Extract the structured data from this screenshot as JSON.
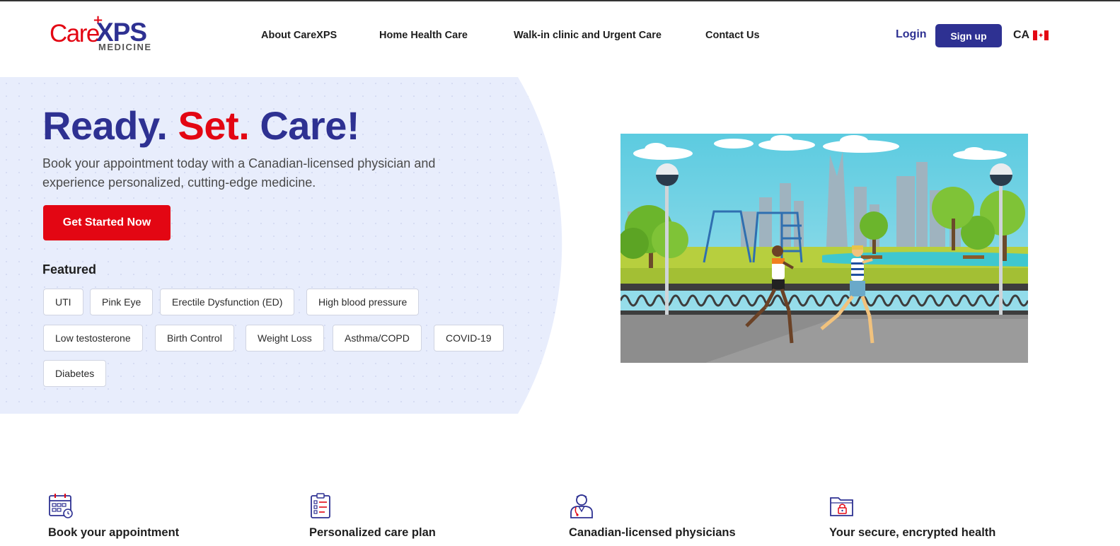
{
  "header": {
    "logo": {
      "brand_care": "Care",
      "brand_xps": "XPS",
      "brand_sub": "MEDICINE"
    },
    "nav": [
      {
        "label": "About CareXPS"
      },
      {
        "label": "Home Health Care"
      },
      {
        "label": "Walk-in clinic and Urgent Care"
      },
      {
        "label": "Contact Us"
      }
    ],
    "login_label": "Login",
    "signup_label": "Sign up",
    "country_label": "CA",
    "flag_icon": "canada-flag-icon"
  },
  "hero": {
    "title_part1": "Ready.",
    "title_part2": "Set.",
    "title_part3": "Care!",
    "subtitle": "Book your appointment today with a Canadian-licensed physician and experience personalized, cutting-edge medicine.",
    "cta_label": "Get Started Now",
    "featured_label": "Featured",
    "featured": [
      {
        "label": "UTI"
      },
      {
        "label": "Pink Eye"
      },
      {
        "label": "Erectile Dysfunction (ED)"
      },
      {
        "label": "High blood pressure"
      },
      {
        "label": "Low testosterone"
      },
      {
        "label": "Birth Control"
      },
      {
        "label": "Weight Loss"
      },
      {
        "label": "Asthma/COPD"
      },
      {
        "label": "COVID-19"
      },
      {
        "label": "Diabetes"
      }
    ],
    "illustration": "park-jogging-illustration"
  },
  "features": [
    {
      "icon": "calendar-clock-icon",
      "title": "Book your appointment"
    },
    {
      "icon": "clipboard-checklist-icon",
      "title": "Personalized care plan"
    },
    {
      "icon": "doctor-icon",
      "title": "Canadian-licensed physicians"
    },
    {
      "icon": "secure-folder-icon",
      "title": "Your secure, encrypted health"
    }
  ],
  "colors": {
    "brand_blue": "#2e3192",
    "brand_red": "#e30613",
    "hero_bg": "#e8edfc"
  }
}
